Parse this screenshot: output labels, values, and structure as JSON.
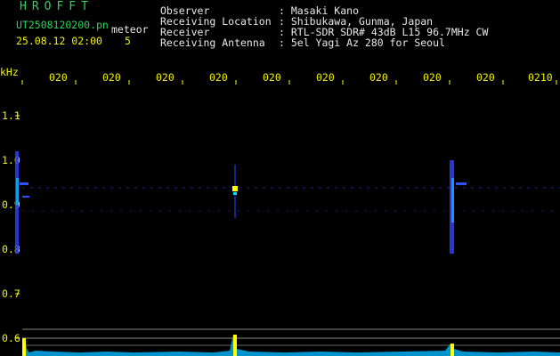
{
  "app": {
    "title": "HROFFT",
    "filename": "UT2508120200.pn",
    "mode": "meteor",
    "datetime": "25.08.12 02:00",
    "count": "5"
  },
  "info": {
    "labels": [
      "Observer",
      "Receiving Location",
      "Receiver",
      "Receiving Antenna"
    ],
    "values": [
      ": Masaki Kano",
      ": Shibukawa, Gunma, Japan",
      ": RTL-SDR SDR# 43dB L15 96.7MHz CW",
      ": 5el Yagi Az 280 for Seoul"
    ]
  },
  "axis": {
    "unit": "kHz",
    "time_ticks": [
      "020",
      "020",
      "020",
      "020",
      "020",
      "020",
      "020",
      "020",
      "020",
      "0210"
    ],
    "freq_ticks": [
      "1.1",
      "1.0",
      "0.9",
      "0.8",
      "0.7",
      "0.6"
    ]
  },
  "colors": {
    "text_green": "#2bd35a",
    "text_yellow": "#f2f200",
    "background": "#000000",
    "signal_blue": "#2a3fff",
    "signal_cyan": "#00e0ff",
    "signal_yellow": "#ffff00"
  }
}
